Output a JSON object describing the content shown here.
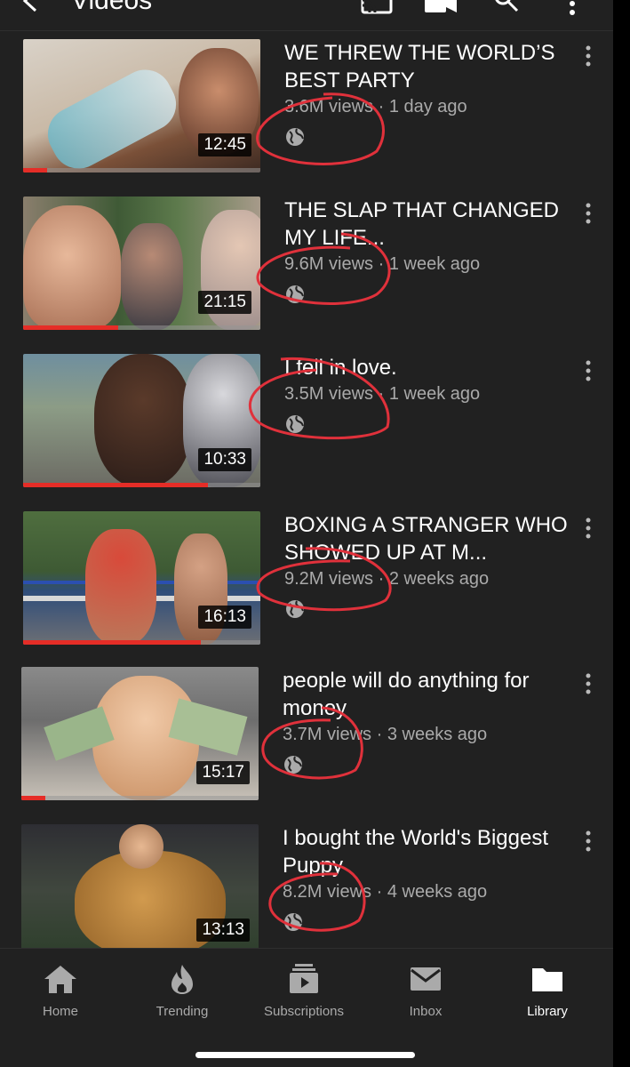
{
  "header": {
    "title": "Videos",
    "icons": [
      "back-arrow-icon",
      "cast-icon",
      "camera-icon",
      "search-icon",
      "more-vert-icon"
    ]
  },
  "videos": [
    {
      "title": "WE THREW THE WORLD’S BEST PARTY",
      "views": "3.6M views",
      "age": "1 day ago",
      "duration": "12:45",
      "visibility_icon": "globe-icon",
      "watched_fraction": 0.1
    },
    {
      "title": "THE SLAP THAT CHANGED MY LIFE...",
      "views": "9.6M views",
      "age": "1 week ago",
      "duration": "21:15",
      "visibility_icon": "globe-icon",
      "watched_fraction": 0.4
    },
    {
      "title": "I fell in love.",
      "views": "3.5M views",
      "age": "1 week ago",
      "duration": "10:33",
      "visibility_icon": "globe-icon",
      "watched_fraction": 0.78
    },
    {
      "title": "BOXING A STRANGER WHO SHOWED UP AT M...",
      "views": "9.2M views",
      "age": "2 weeks ago",
      "duration": "16:13",
      "visibility_icon": "globe-icon",
      "watched_fraction": 0.75
    },
    {
      "title": "people will do anything for money",
      "views": "3.7M views",
      "age": "3 weeks ago",
      "duration": "15:17",
      "visibility_icon": "globe-icon",
      "watched_fraction": 0.1
    },
    {
      "title": "I bought the World's Biggest Puppy",
      "views": "8.2M views",
      "age": "4 weeks ago",
      "duration": "13:13",
      "visibility_icon": "globe-icon",
      "watched_fraction": 0
    }
  ],
  "separator": "·",
  "bottom_nav": [
    {
      "label": "Home",
      "icon": "home-icon",
      "active": false
    },
    {
      "label": "Trending",
      "icon": "flame-icon",
      "active": false
    },
    {
      "label": "Subscriptions",
      "icon": "subscriptions-icon",
      "active": false
    },
    {
      "label": "Inbox",
      "icon": "mail-icon",
      "active": false
    },
    {
      "label": "Library",
      "icon": "folder-icon",
      "active": true
    }
  ],
  "colors": {
    "background": "#212121",
    "progress": "#e52d27",
    "annotation_circle": "#e0313b",
    "secondary_text": "#aaaaaa"
  }
}
